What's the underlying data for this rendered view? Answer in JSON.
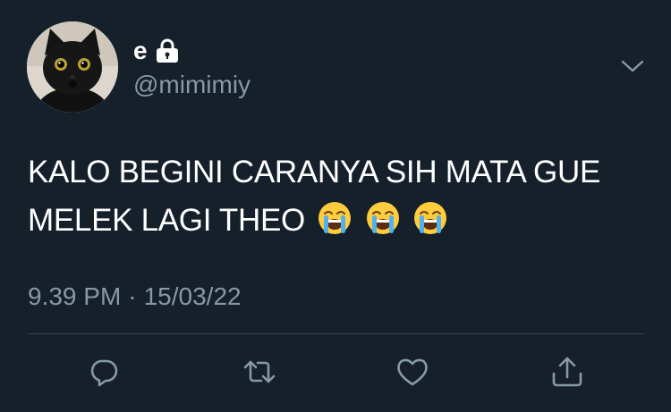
{
  "author": {
    "display_name": "e",
    "handle": "@mimimiy",
    "avatar": "black-cat-avatar",
    "protected_icon": "lock-icon"
  },
  "tweet": {
    "text": "KALO BEGINI CARANYA SIH MATA GUE MELEK LAGI THEO",
    "emojis": [
      "loudly-crying-face",
      "loudly-crying-face",
      "loudly-crying-face"
    ],
    "time": "9.39 PM",
    "separator": "·",
    "date": "15/03/22"
  },
  "actions": {
    "reply_icon": "reply-icon",
    "retweet_icon": "retweet-icon",
    "like_icon": "heart-icon",
    "share_icon": "share-icon"
  },
  "colors": {
    "background": "#15202b",
    "primary_text": "#ffffff",
    "secondary_text": "#8899a6",
    "divider": "#38444d"
  }
}
